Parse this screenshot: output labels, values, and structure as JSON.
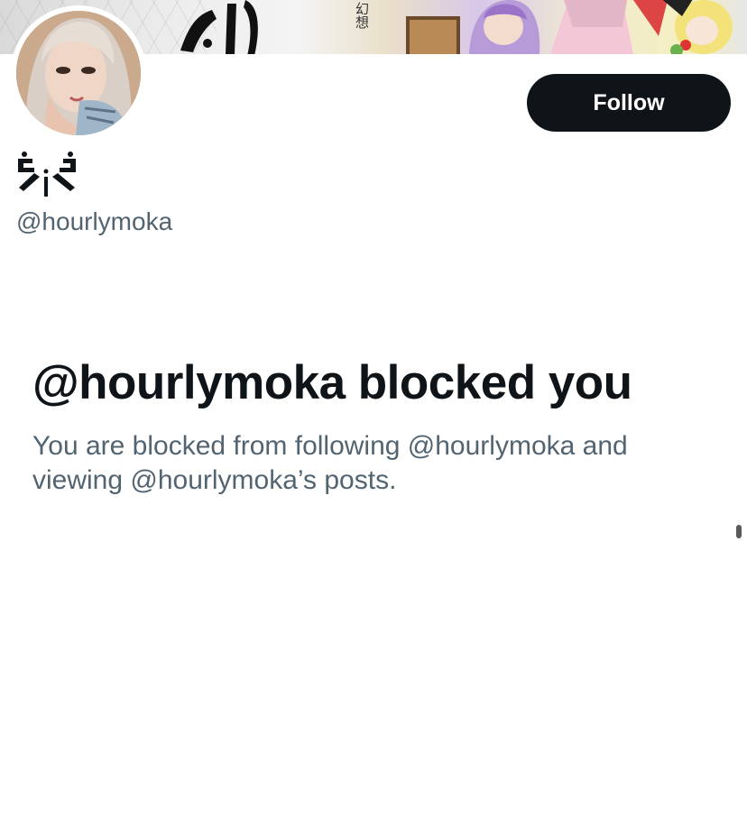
{
  "banner": {
    "kanji": "幻想"
  },
  "profile": {
    "display_name_icon": "custom-glyph-icon",
    "handle": "@hourlymoka"
  },
  "actions": {
    "follow_label": "Follow"
  },
  "blocked": {
    "title": "@hourlymoka blocked you",
    "description": "You are blocked from following @hourlymoka and viewing @hourlymoka’s posts."
  },
  "colors": {
    "primary_text": "#0f1419",
    "secondary_text": "#536471",
    "button_bg": "#0f1419",
    "button_text": "#ffffff",
    "background": "#ffffff"
  }
}
